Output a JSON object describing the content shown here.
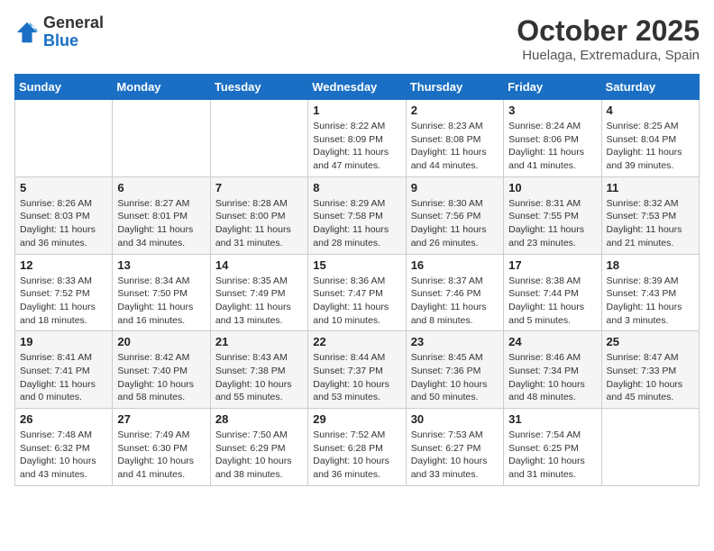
{
  "header": {
    "logo_general": "General",
    "logo_blue": "Blue",
    "month_title": "October 2025",
    "location": "Huelaga, Extremadura, Spain"
  },
  "calendar": {
    "days_of_week": [
      "Sunday",
      "Monday",
      "Tuesday",
      "Wednesday",
      "Thursday",
      "Friday",
      "Saturday"
    ],
    "weeks": [
      [
        {
          "day": "",
          "info": ""
        },
        {
          "day": "",
          "info": ""
        },
        {
          "day": "",
          "info": ""
        },
        {
          "day": "1",
          "info": "Sunrise: 8:22 AM\nSunset: 8:09 PM\nDaylight: 11 hours and 47 minutes."
        },
        {
          "day": "2",
          "info": "Sunrise: 8:23 AM\nSunset: 8:08 PM\nDaylight: 11 hours and 44 minutes."
        },
        {
          "day": "3",
          "info": "Sunrise: 8:24 AM\nSunset: 8:06 PM\nDaylight: 11 hours and 41 minutes."
        },
        {
          "day": "4",
          "info": "Sunrise: 8:25 AM\nSunset: 8:04 PM\nDaylight: 11 hours and 39 minutes."
        }
      ],
      [
        {
          "day": "5",
          "info": "Sunrise: 8:26 AM\nSunset: 8:03 PM\nDaylight: 11 hours and 36 minutes."
        },
        {
          "day": "6",
          "info": "Sunrise: 8:27 AM\nSunset: 8:01 PM\nDaylight: 11 hours and 34 minutes."
        },
        {
          "day": "7",
          "info": "Sunrise: 8:28 AM\nSunset: 8:00 PM\nDaylight: 11 hours and 31 minutes."
        },
        {
          "day": "8",
          "info": "Sunrise: 8:29 AM\nSunset: 7:58 PM\nDaylight: 11 hours and 28 minutes."
        },
        {
          "day": "9",
          "info": "Sunrise: 8:30 AM\nSunset: 7:56 PM\nDaylight: 11 hours and 26 minutes."
        },
        {
          "day": "10",
          "info": "Sunrise: 8:31 AM\nSunset: 7:55 PM\nDaylight: 11 hours and 23 minutes."
        },
        {
          "day": "11",
          "info": "Sunrise: 8:32 AM\nSunset: 7:53 PM\nDaylight: 11 hours and 21 minutes."
        }
      ],
      [
        {
          "day": "12",
          "info": "Sunrise: 8:33 AM\nSunset: 7:52 PM\nDaylight: 11 hours and 18 minutes."
        },
        {
          "day": "13",
          "info": "Sunrise: 8:34 AM\nSunset: 7:50 PM\nDaylight: 11 hours and 16 minutes."
        },
        {
          "day": "14",
          "info": "Sunrise: 8:35 AM\nSunset: 7:49 PM\nDaylight: 11 hours and 13 minutes."
        },
        {
          "day": "15",
          "info": "Sunrise: 8:36 AM\nSunset: 7:47 PM\nDaylight: 11 hours and 10 minutes."
        },
        {
          "day": "16",
          "info": "Sunrise: 8:37 AM\nSunset: 7:46 PM\nDaylight: 11 hours and 8 minutes."
        },
        {
          "day": "17",
          "info": "Sunrise: 8:38 AM\nSunset: 7:44 PM\nDaylight: 11 hours and 5 minutes."
        },
        {
          "day": "18",
          "info": "Sunrise: 8:39 AM\nSunset: 7:43 PM\nDaylight: 11 hours and 3 minutes."
        }
      ],
      [
        {
          "day": "19",
          "info": "Sunrise: 8:41 AM\nSunset: 7:41 PM\nDaylight: 11 hours and 0 minutes."
        },
        {
          "day": "20",
          "info": "Sunrise: 8:42 AM\nSunset: 7:40 PM\nDaylight: 10 hours and 58 minutes."
        },
        {
          "day": "21",
          "info": "Sunrise: 8:43 AM\nSunset: 7:38 PM\nDaylight: 10 hours and 55 minutes."
        },
        {
          "day": "22",
          "info": "Sunrise: 8:44 AM\nSunset: 7:37 PM\nDaylight: 10 hours and 53 minutes."
        },
        {
          "day": "23",
          "info": "Sunrise: 8:45 AM\nSunset: 7:36 PM\nDaylight: 10 hours and 50 minutes."
        },
        {
          "day": "24",
          "info": "Sunrise: 8:46 AM\nSunset: 7:34 PM\nDaylight: 10 hours and 48 minutes."
        },
        {
          "day": "25",
          "info": "Sunrise: 8:47 AM\nSunset: 7:33 PM\nDaylight: 10 hours and 45 minutes."
        }
      ],
      [
        {
          "day": "26",
          "info": "Sunrise: 7:48 AM\nSunset: 6:32 PM\nDaylight: 10 hours and 43 minutes."
        },
        {
          "day": "27",
          "info": "Sunrise: 7:49 AM\nSunset: 6:30 PM\nDaylight: 10 hours and 41 minutes."
        },
        {
          "day": "28",
          "info": "Sunrise: 7:50 AM\nSunset: 6:29 PM\nDaylight: 10 hours and 38 minutes."
        },
        {
          "day": "29",
          "info": "Sunrise: 7:52 AM\nSunset: 6:28 PM\nDaylight: 10 hours and 36 minutes."
        },
        {
          "day": "30",
          "info": "Sunrise: 7:53 AM\nSunset: 6:27 PM\nDaylight: 10 hours and 33 minutes."
        },
        {
          "day": "31",
          "info": "Sunrise: 7:54 AM\nSunset: 6:25 PM\nDaylight: 10 hours and 31 minutes."
        },
        {
          "day": "",
          "info": ""
        }
      ]
    ]
  }
}
